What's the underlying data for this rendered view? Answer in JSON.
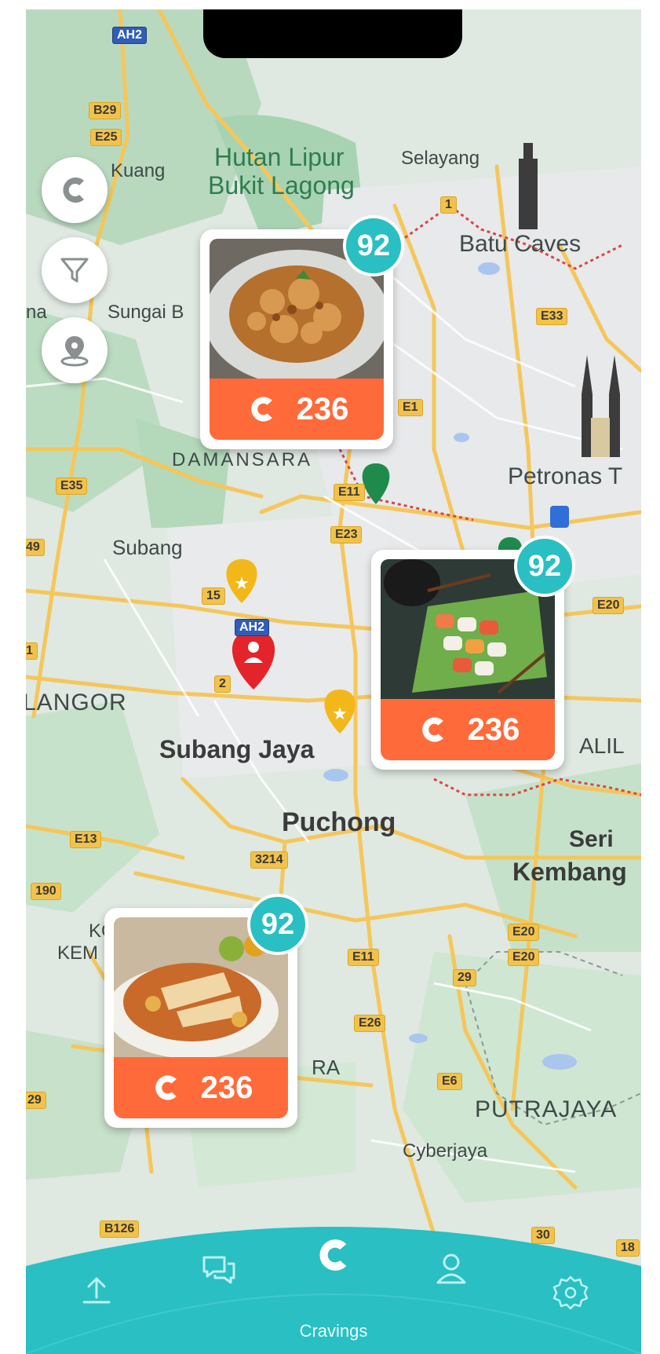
{
  "map": {
    "labels": [
      {
        "text": "Hutan Lipur",
        "style": "green"
      },
      {
        "text": "Bukit Lagong",
        "style": "green"
      },
      {
        "text": "Selayang",
        "style": ""
      },
      {
        "text": "Kuang",
        "style": ""
      },
      {
        "text": "Batu Caves",
        "style": ""
      },
      {
        "text": "Sungai B",
        "style": ""
      },
      {
        "text": "na",
        "style": ""
      },
      {
        "text": "DAMANSARA",
        "style": ""
      },
      {
        "text": "Petronas T",
        "style": ""
      },
      {
        "text": "Subang",
        "style": ""
      },
      {
        "text": "LANGOR",
        "style": ""
      },
      {
        "text": "Subang Jaya",
        "style": "bold"
      },
      {
        "text": "ALIL",
        "style": ""
      },
      {
        "text": "Puchong",
        "style": "bold"
      },
      {
        "text": "Seri",
        "style": "bold"
      },
      {
        "text": "Kembang",
        "style": "bold"
      },
      {
        "text": "KOT",
        "style": ""
      },
      {
        "text": "KEM",
        "style": ""
      },
      {
        "text": "RA",
        "style": ""
      },
      {
        "text": "PUTRAJAYA",
        "style": ""
      },
      {
        "text": "Cyberjaya",
        "style": ""
      }
    ],
    "roads": [
      "AH2",
      "B29",
      "E25",
      "1",
      "E33",
      "E1",
      "E35",
      "E11",
      "E23",
      "49",
      "15",
      "AH2",
      "1",
      "2",
      "E20",
      "E13",
      "3214",
      "190",
      "E20",
      "E20",
      "E11",
      "29",
      "E26",
      "E6",
      "29",
      "B126",
      "30",
      "18"
    ]
  },
  "controls": {
    "brand_button": "brand-logo",
    "filter_button": "filter",
    "location_button": "location-pin"
  },
  "cards": [
    {
      "score": "92",
      "count": "236",
      "dish": "fried crispy dish"
    },
    {
      "score": "92",
      "count": "236",
      "dish": "sushi platter"
    },
    {
      "score": "92",
      "count": "236",
      "dish": "noodle soup with chicken"
    }
  ],
  "nav": {
    "active_label": "Cravings",
    "items": [
      "upload",
      "chat",
      "cravings",
      "profile",
      "settings"
    ]
  },
  "colors": {
    "accent": "#29bfc3",
    "brand_orange": "#ff6a3a",
    "map_bg": "#d9e6dc"
  }
}
